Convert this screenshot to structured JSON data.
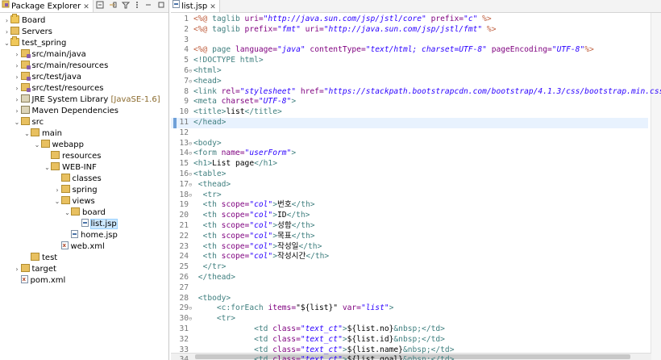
{
  "package_explorer": {
    "title": "Package Explorer",
    "close": "✕",
    "items": [
      {
        "indent": 0,
        "arrow": "›",
        "icon": "project",
        "label": "Board"
      },
      {
        "indent": 0,
        "arrow": "›",
        "icon": "folder",
        "label": "Servers"
      },
      {
        "indent": 0,
        "arrow": "⌄",
        "icon": "project",
        "label": "test_spring"
      },
      {
        "indent": 1,
        "arrow": "›",
        "icon": "pkgfolder",
        "label": "src/main/java"
      },
      {
        "indent": 1,
        "arrow": "›",
        "icon": "pkgfolder",
        "label": "src/main/resources"
      },
      {
        "indent": 1,
        "arrow": "›",
        "icon": "pkgfolder",
        "label": "src/test/java"
      },
      {
        "indent": 1,
        "arrow": "›",
        "icon": "pkgfolder",
        "label": "src/test/resources"
      },
      {
        "indent": 1,
        "arrow": "›",
        "icon": "lib",
        "label": "JRE System Library",
        "suffix": " [JavaSE-1.6]"
      },
      {
        "indent": 1,
        "arrow": "›",
        "icon": "lib",
        "label": "Maven Dependencies"
      },
      {
        "indent": 1,
        "arrow": "⌄",
        "icon": "folder",
        "label": "src"
      },
      {
        "indent": 2,
        "arrow": "⌄",
        "icon": "folder",
        "label": "main"
      },
      {
        "indent": 3,
        "arrow": "⌄",
        "icon": "folder",
        "label": "webapp"
      },
      {
        "indent": 4,
        "arrow": "",
        "icon": "folder",
        "label": "resources"
      },
      {
        "indent": 4,
        "arrow": "⌄",
        "icon": "folder",
        "label": "WEB-INF"
      },
      {
        "indent": 5,
        "arrow": "",
        "icon": "folder",
        "label": "classes"
      },
      {
        "indent": 5,
        "arrow": "›",
        "icon": "folder",
        "label": "spring"
      },
      {
        "indent": 5,
        "arrow": "⌄",
        "icon": "folder",
        "label": "views"
      },
      {
        "indent": 6,
        "arrow": "⌄",
        "icon": "folder",
        "label": "board"
      },
      {
        "indent": 7,
        "arrow": "",
        "icon": "jsp",
        "label": "list.jsp",
        "selected": true
      },
      {
        "indent": 6,
        "arrow": "",
        "icon": "jsp",
        "label": "home.jsp"
      },
      {
        "indent": 5,
        "arrow": "",
        "icon": "xml",
        "label": "web.xml"
      },
      {
        "indent": 2,
        "arrow": "",
        "icon": "folder",
        "label": "test"
      },
      {
        "indent": 1,
        "arrow": "›",
        "icon": "folder",
        "label": "target"
      },
      {
        "indent": 1,
        "arrow": "",
        "icon": "xml",
        "label": "pom.xml"
      }
    ]
  },
  "editor": {
    "tab_label": "list.jsp",
    "tab_close": "✕",
    "current_line": 11,
    "lines": [
      {
        "n": "1",
        "fold": "",
        "segs": [
          [
            "dir",
            "<%@ "
          ],
          [
            "tag",
            "taglib "
          ],
          [
            "attr",
            "uri="
          ],
          [
            "val",
            "\"http://java.sun.com/jsp/jstl/core\""
          ],
          [
            "attr",
            " prefix="
          ],
          [
            "val",
            "\"c\""
          ],
          [
            "dir",
            " %>"
          ]
        ]
      },
      {
        "n": "2",
        "fold": "",
        "segs": [
          [
            "dir",
            "<%@ "
          ],
          [
            "tag",
            "taglib "
          ],
          [
            "attr",
            "prefix="
          ],
          [
            "val",
            "\"fmt\""
          ],
          [
            "attr",
            " uri="
          ],
          [
            "val",
            "\"http://java.sun.com/jsp/jstl/fmt\""
          ],
          [
            "dir",
            " %>"
          ]
        ]
      },
      {
        "n": "3",
        "fold": "",
        "segs": []
      },
      {
        "n": "4",
        "fold": "",
        "segs": [
          [
            "dir",
            "<%@ "
          ],
          [
            "tag",
            "page "
          ],
          [
            "attr",
            "language="
          ],
          [
            "val",
            "\"java\""
          ],
          [
            "attr",
            " contentType="
          ],
          [
            "val",
            "\"text/html; charset=UTF-8\""
          ],
          [
            "attr",
            " pageEncoding="
          ],
          [
            "val",
            "\"UTF-8\""
          ],
          [
            "dir",
            "%>"
          ]
        ]
      },
      {
        "n": "5",
        "fold": "",
        "segs": [
          [
            "tag",
            "<!DOCTYPE html>"
          ]
        ]
      },
      {
        "n": "6",
        "fold": "⊖",
        "segs": [
          [
            "tag",
            "<html>"
          ]
        ]
      },
      {
        "n": "7",
        "fold": "⊖",
        "segs": [
          [
            "tag",
            "<head>"
          ]
        ]
      },
      {
        "n": "8",
        "fold": "",
        "segs": [
          [
            "tag",
            "<link "
          ],
          [
            "attr",
            "rel="
          ],
          [
            "val",
            "\"stylesheet\""
          ],
          [
            "attr",
            " href="
          ],
          [
            "val",
            "\"https://stackpath.bootstrapcdn.com/bootstrap/4.1.3/css/bootstrap.min.css\""
          ]
        ]
      },
      {
        "n": "9",
        "fold": "",
        "segs": [
          [
            "tag",
            "<meta "
          ],
          [
            "attr",
            "charset="
          ],
          [
            "val",
            "\"UTF-8\""
          ],
          [
            "tag",
            ">"
          ]
        ]
      },
      {
        "n": "10",
        "fold": "",
        "segs": [
          [
            "tag",
            "<title>"
          ],
          [
            "txt",
            "list"
          ],
          [
            "tag",
            "</title>"
          ]
        ]
      },
      {
        "n": "11",
        "fold": "",
        "segs": [
          [
            "tag",
            "</head>"
          ]
        ]
      },
      {
        "n": "12",
        "fold": "",
        "segs": []
      },
      {
        "n": "13",
        "fold": "⊖",
        "segs": [
          [
            "tag",
            "<body>"
          ]
        ]
      },
      {
        "n": "14",
        "fold": "⊖",
        "segs": [
          [
            "tag",
            "<form "
          ],
          [
            "attr",
            "name="
          ],
          [
            "val",
            "\"userForm\""
          ],
          [
            "tag",
            ">"
          ]
        ]
      },
      {
        "n": "15",
        "fold": "",
        "segs": [
          [
            "tag",
            "<h1>"
          ],
          [
            "txt",
            "List page"
          ],
          [
            "tag",
            "</h1>"
          ]
        ]
      },
      {
        "n": "16",
        "fold": "⊖",
        "segs": [
          [
            "tag",
            "<table>"
          ]
        ]
      },
      {
        "n": "17",
        "fold": "⊖",
        "segs": [
          [
            "txt",
            " "
          ],
          [
            "tag",
            "<thead>"
          ]
        ]
      },
      {
        "n": "18",
        "fold": "⊖",
        "segs": [
          [
            "txt",
            "  "
          ],
          [
            "tag",
            "<tr>"
          ]
        ]
      },
      {
        "n": "19",
        "fold": "",
        "segs": [
          [
            "txt",
            "  "
          ],
          [
            "tag",
            "<th "
          ],
          [
            "attr",
            "scope="
          ],
          [
            "val",
            "\"col\""
          ],
          [
            "tag",
            ">"
          ],
          [
            "txt",
            "번호"
          ],
          [
            "tag",
            "</th>"
          ]
        ]
      },
      {
        "n": "20",
        "fold": "",
        "segs": [
          [
            "txt",
            "  "
          ],
          [
            "tag",
            "<th "
          ],
          [
            "attr",
            "scope="
          ],
          [
            "val",
            "\"col\""
          ],
          [
            "tag",
            ">"
          ],
          [
            "txt",
            "ID"
          ],
          [
            "tag",
            "</th>"
          ]
        ]
      },
      {
        "n": "21",
        "fold": "",
        "segs": [
          [
            "txt",
            "  "
          ],
          [
            "tag",
            "<th "
          ],
          [
            "attr",
            "scope="
          ],
          [
            "val",
            "\"col\""
          ],
          [
            "tag",
            ">"
          ],
          [
            "txt",
            "성함"
          ],
          [
            "tag",
            "</th>"
          ]
        ]
      },
      {
        "n": "22",
        "fold": "",
        "segs": [
          [
            "txt",
            "  "
          ],
          [
            "tag",
            "<th "
          ],
          [
            "attr",
            "scope="
          ],
          [
            "val",
            "\"col\""
          ],
          [
            "tag",
            ">"
          ],
          [
            "txt",
            "목표"
          ],
          [
            "tag",
            "</th>"
          ]
        ]
      },
      {
        "n": "23",
        "fold": "",
        "segs": [
          [
            "txt",
            "  "
          ],
          [
            "tag",
            "<th "
          ],
          [
            "attr",
            "scope="
          ],
          [
            "val",
            "\"col\""
          ],
          [
            "tag",
            ">"
          ],
          [
            "txt",
            "작성일"
          ],
          [
            "tag",
            "</th>"
          ]
        ]
      },
      {
        "n": "24",
        "fold": "",
        "segs": [
          [
            "txt",
            "  "
          ],
          [
            "tag",
            "<th "
          ],
          [
            "attr",
            "scope="
          ],
          [
            "val",
            "\"col\""
          ],
          [
            "tag",
            ">"
          ],
          [
            "txt",
            "작성시간"
          ],
          [
            "tag",
            "</th>"
          ]
        ]
      },
      {
        "n": "25",
        "fold": "",
        "segs": [
          [
            "txt",
            "  "
          ],
          [
            "tag",
            "</tr>"
          ]
        ]
      },
      {
        "n": "26",
        "fold": "",
        "segs": [
          [
            "txt",
            " "
          ],
          [
            "tag",
            "</thead>"
          ]
        ]
      },
      {
        "n": "27",
        "fold": "",
        "segs": []
      },
      {
        "n": "28",
        "fold": "",
        "segs": [
          [
            "txt",
            " "
          ],
          [
            "tag",
            "<tbody>"
          ]
        ]
      },
      {
        "n": "29",
        "fold": "⊖",
        "segs": [
          [
            "txt",
            "     "
          ],
          [
            "tag",
            "<c:forEach "
          ],
          [
            "attr",
            "items="
          ],
          [
            "txt",
            "\"${list}\""
          ],
          [
            "attr",
            " var="
          ],
          [
            "val",
            "\"list\""
          ],
          [
            "tag",
            ">"
          ]
        ]
      },
      {
        "n": "30",
        "fold": "⊖",
        "segs": [
          [
            "txt",
            "     "
          ],
          [
            "tag",
            "<tr>"
          ]
        ]
      },
      {
        "n": "31",
        "fold": "",
        "segs": [
          [
            "txt",
            "             "
          ],
          [
            "tag",
            "<td "
          ],
          [
            "attr",
            "class="
          ],
          [
            "val",
            "\"text_ct\""
          ],
          [
            "tag",
            ">"
          ],
          [
            "txt",
            "${list.no}"
          ],
          [
            "tag",
            "&nbsp;"
          ],
          [
            "tag",
            "</td>"
          ]
        ]
      },
      {
        "n": "32",
        "fold": "",
        "segs": [
          [
            "txt",
            "             "
          ],
          [
            "tag",
            "<td "
          ],
          [
            "attr",
            "class="
          ],
          [
            "val",
            "\"text_ct\""
          ],
          [
            "tag",
            ">"
          ],
          [
            "txt",
            "${list.id}"
          ],
          [
            "tag",
            "&nbsp;"
          ],
          [
            "tag",
            "</td>"
          ]
        ]
      },
      {
        "n": "33",
        "fold": "",
        "segs": [
          [
            "txt",
            "             "
          ],
          [
            "tag",
            "<td "
          ],
          [
            "attr",
            "class="
          ],
          [
            "val",
            "\"text_ct\""
          ],
          [
            "tag",
            ">"
          ],
          [
            "txt",
            "${list.name}"
          ],
          [
            "tag",
            "&nbsp;"
          ],
          [
            "tag",
            "</td>"
          ]
        ]
      },
      {
        "n": "34",
        "fold": "",
        "segs": [
          [
            "txt",
            "             "
          ],
          [
            "tag",
            "<td "
          ],
          [
            "attr",
            "class="
          ],
          [
            "val",
            "\"text_ct\""
          ],
          [
            "tag",
            ">"
          ],
          [
            "txt",
            "${list.goal}"
          ],
          [
            "tag",
            "&nbsp;"
          ],
          [
            "tag",
            "</td>"
          ]
        ]
      }
    ]
  }
}
